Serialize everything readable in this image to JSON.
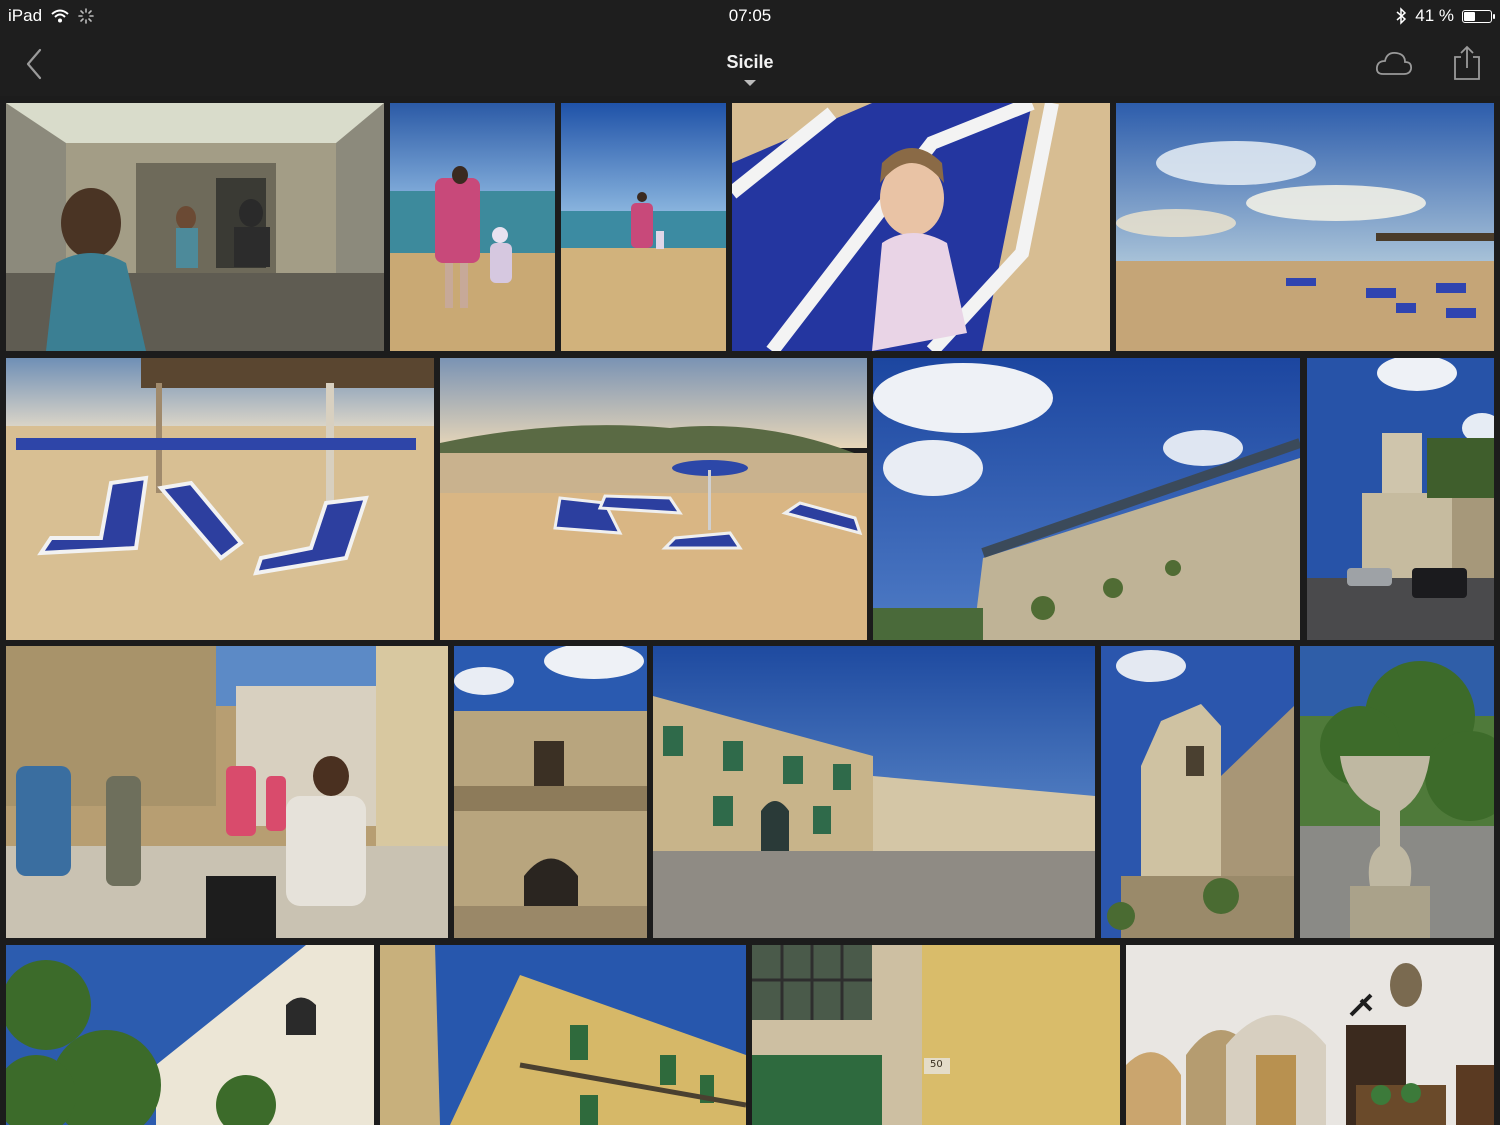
{
  "status_bar": {
    "device": "iPad",
    "time": "07:05",
    "battery": "41 %",
    "battery_level": 0.41,
    "icons": [
      "wifi-icon",
      "activity-spinner-icon",
      "bluetooth-icon",
      "battery-icon"
    ]
  },
  "nav": {
    "title": "Sicile",
    "icons": [
      "back-chevron-icon",
      "cloud-icon",
      "share-icon",
      "title-dropdown-caret-icon"
    ]
  },
  "photos": [
    {
      "id": "elevator-mirror-selfie"
    },
    {
      "id": "beach-mother-child-shore"
    },
    {
      "id": "beach-shore-wide"
    },
    {
      "id": "baby-on-sun-lounger"
    },
    {
      "id": "beach-panorama-clouds"
    },
    {
      "id": "beach-lounger-rows"
    },
    {
      "id": "beach-wall-umbrella"
    },
    {
      "id": "stone-wall-railing-sky"
    },
    {
      "id": "church-tower-street"
    },
    {
      "id": "street-crowd-tourists"
    },
    {
      "id": "baroque-balcony-facade"
    },
    {
      "id": "town-square-palazzo"
    },
    {
      "id": "church-bell-tower"
    },
    {
      "id": "stone-urn-garden"
    },
    {
      "id": "white-church-trees"
    },
    {
      "id": "yellow-building-balconies"
    },
    {
      "id": "yellow-wall-green-door",
      "label": "50"
    },
    {
      "id": "church-interior-altar"
    }
  ],
  "colors": {
    "background": "#1c1c1c",
    "bar": "#1e1e1e",
    "sky": "#2f5fb0",
    "sand": "#d6b98a",
    "lounger_blue": "#2c3f9e",
    "stone": "#b9a580"
  }
}
